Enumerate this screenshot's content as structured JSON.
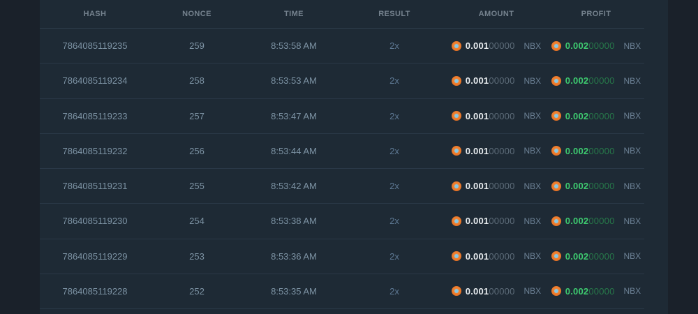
{
  "header": {
    "columns": [
      "HASH",
      "NONCE",
      "TIME",
      "RESULT",
      "AMOUNT",
      "PROFIT"
    ]
  },
  "rows": [
    {
      "hash": "7864085119235",
      "nonce": "259",
      "time": "8:53:58 AM",
      "result": "2x",
      "amount": {
        "value": "0.001",
        "zeros": "00000",
        "unit": "NBX"
      },
      "profit": {
        "value": "0.002",
        "zeros": "00000",
        "unit": "NBX"
      }
    },
    {
      "hash": "7864085119234",
      "nonce": "258",
      "time": "8:53:53 AM",
      "result": "2x",
      "amount": {
        "value": "0.001",
        "zeros": "00000",
        "unit": "NBX"
      },
      "profit": {
        "value": "0.002",
        "zeros": "00000",
        "unit": "NBX"
      }
    },
    {
      "hash": "7864085119233",
      "nonce": "257",
      "time": "8:53:47 AM",
      "result": "2x",
      "amount": {
        "value": "0.001",
        "zeros": "00000",
        "unit": "NBX"
      },
      "profit": {
        "value": "0.002",
        "zeros": "00000",
        "unit": "NBX"
      }
    },
    {
      "hash": "7864085119232",
      "nonce": "256",
      "time": "8:53:44 AM",
      "result": "2x",
      "amount": {
        "value": "0.001",
        "zeros": "00000",
        "unit": "NBX"
      },
      "profit": {
        "value": "0.002",
        "zeros": "00000",
        "unit": "NBX"
      }
    },
    {
      "hash": "7864085119231",
      "nonce": "255",
      "time": "8:53:42 AM",
      "result": "2x",
      "amount": {
        "value": "0.001",
        "zeros": "00000",
        "unit": "NBX"
      },
      "profit": {
        "value": "0.002",
        "zeros": "00000",
        "unit": "NBX"
      }
    },
    {
      "hash": "7864085119230",
      "nonce": "254",
      "time": "8:53:38 AM",
      "result": "2x",
      "amount": {
        "value": "0.001",
        "zeros": "00000",
        "unit": "NBX"
      },
      "profit": {
        "value": "0.002",
        "zeros": "00000",
        "unit": "NBX"
      }
    },
    {
      "hash": "7864085119229",
      "nonce": "253",
      "time": "8:53:36 AM",
      "result": "2x",
      "amount": {
        "value": "0.001",
        "zeros": "00000",
        "unit": "NBX"
      },
      "profit": {
        "value": "0.002",
        "zeros": "00000",
        "unit": "NBX"
      }
    },
    {
      "hash": "7864085119228",
      "nonce": "252",
      "time": "8:53:35 AM",
      "result": "2x",
      "amount": {
        "value": "0.001",
        "zeros": "00000",
        "unit": "NBX"
      },
      "profit": {
        "value": "0.002",
        "zeros": "00000",
        "unit": "NBX"
      }
    }
  ],
  "icons": {
    "coin": "nbx-coin-icon"
  },
  "colors": {
    "page_bg": "#1a212a",
    "panel_bg": "#1e2a35",
    "divider": "#2e3d4b",
    "header_text": "#75828e",
    "row_text": "#7d93a4",
    "amount_main": "#e9edf0",
    "amount_zeros": "#5d6c79",
    "profit_main": "#3ecb70",
    "profit_zeros": "#27794a",
    "unit_text": "#6d8296",
    "coin_orange": "#ec7a2a",
    "coin_center_blue": "#87c8e4"
  }
}
